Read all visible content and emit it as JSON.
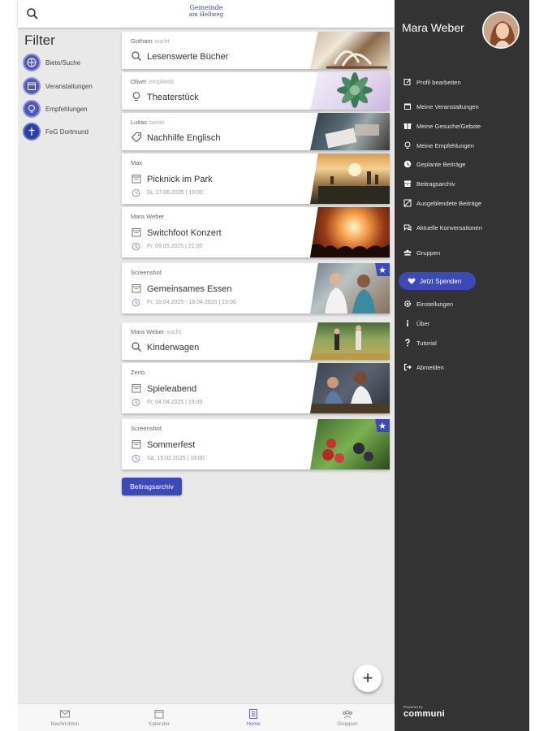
{
  "header": {
    "logo_line1": "Gemeinde",
    "logo_line2": "am Hellweg"
  },
  "filter": {
    "title": "Filter",
    "items": [
      {
        "label": "Biete/Suche",
        "icon": "exchange-icon"
      },
      {
        "label": "Veranstaltungen",
        "icon": "calendar-icon"
      },
      {
        "label": "Empfehlungen",
        "icon": "lightbulb-icon"
      },
      {
        "label": "FeG Dortmund",
        "icon": "church-icon"
      }
    ]
  },
  "posts": [
    {
      "author": "Gotham",
      "action": "sucht",
      "title": "Lesenswerte Bücher",
      "icon": "search-icon",
      "date": "",
      "featured": false
    },
    {
      "author": "Oliver",
      "action": "empfiehlt",
      "title": "Theaterstück",
      "icon": "lightbulb-icon",
      "date": "",
      "featured": false
    },
    {
      "author": "Lukas",
      "action": "bietet",
      "title": "Nachhilfe Englisch",
      "icon": "tag-icon",
      "date": "",
      "featured": false
    },
    {
      "author": "Max",
      "action": "",
      "title": "Picknick im Park",
      "icon": "calendar-icon",
      "date": "Di, 17.06.2025 | 19:00",
      "featured": false
    },
    {
      "author": "Mara Weber",
      "action": "",
      "title": "Switchfoot Konzert",
      "icon": "calendar-icon",
      "date": "Fr, 09.05.2025 | 21:00",
      "featured": false
    },
    {
      "author": "Screenshot",
      "action": "",
      "title": "Gemeinsames Essen",
      "icon": "calendar-icon",
      "date": "Fr, 18.04.2025 - 18.04.2020 | 19:00",
      "featured": true
    },
    {
      "author": "Mara Weber",
      "action": "sucht",
      "title": "Kinderwagen",
      "icon": "search-icon",
      "date": "",
      "featured": false
    },
    {
      "author": "Zeno",
      "action": "",
      "title": "Spieleabend",
      "icon": "calendar-icon",
      "date": "Fr, 04.04.2025 | 19:00",
      "featured": false
    },
    {
      "author": "Screenshot",
      "action": "",
      "title": "Sommerfest",
      "icon": "calendar-icon",
      "date": "Sa, 15.02.2025 | 18:00",
      "featured": true
    }
  ],
  "archive_button": "Beitragsarchiv",
  "fab_label": "+",
  "bottom_nav": [
    {
      "label": "Nachrichten",
      "icon": "mail-icon",
      "active": false
    },
    {
      "label": "Kalender",
      "icon": "calendar-icon",
      "active": false
    },
    {
      "label": "Home",
      "icon": "home-list-icon",
      "active": true
    },
    {
      "label": "Gruppen",
      "icon": "group-icon",
      "active": false
    }
  ],
  "drawer": {
    "user_name": "Mara Weber",
    "menu": [
      {
        "label": "Profil bearbeiten",
        "icon": "edit-icon"
      },
      {
        "label": "Meine Veranstaltungen",
        "icon": "calendar-icon"
      },
      {
        "label": "Meine Gesuche/Gebote",
        "icon": "gift-icon"
      },
      {
        "label": "Meine Empfehlungen",
        "icon": "lightbulb-icon"
      },
      {
        "label": "Geplante Beiträge",
        "icon": "clock-icon"
      },
      {
        "label": "Beitragsarchiv",
        "icon": "archive-icon"
      },
      {
        "label": "Ausgeblendete Beiträge",
        "icon": "hidden-icon"
      },
      {
        "label": "Aktuelle Konversationen",
        "icon": "chat-icon"
      },
      {
        "label": "Gruppen",
        "icon": "group-icon"
      },
      {
        "label": "Einstellungen",
        "icon": "gear-icon"
      },
      {
        "label": "Über",
        "icon": "info-icon"
      },
      {
        "label": "Tutorial",
        "icon": "question-icon"
      },
      {
        "label": "Abmelden",
        "icon": "logout-icon"
      }
    ],
    "donate_label": "Jetzt Spenden",
    "powered_by": "Powered by",
    "brand": "communi"
  },
  "colors": {
    "accent": "#3c49b8",
    "drawer_bg": "#333333",
    "app_bg": "#e9e9e9"
  }
}
